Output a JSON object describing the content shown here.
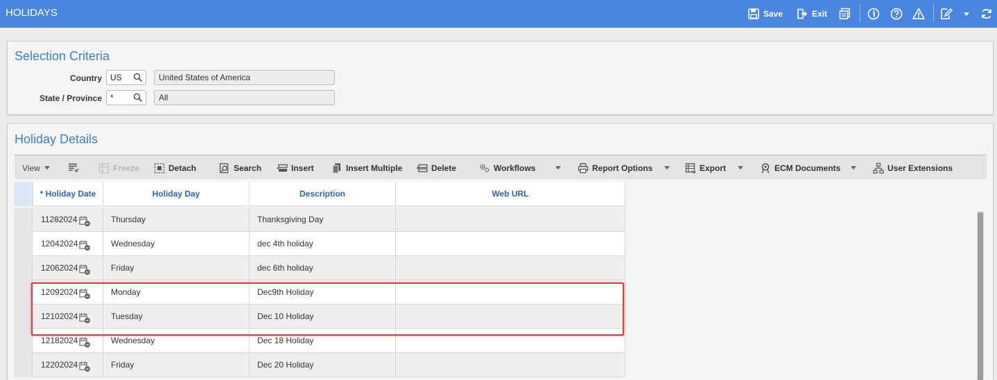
{
  "app": {
    "title": "HOLIDAYS",
    "actions": {
      "save": "Save",
      "exit": "Exit"
    },
    "accent_color": "#4a86e0"
  },
  "selection_criteria": {
    "title": "Selection Criteria",
    "country": {
      "label": "Country",
      "value": "US",
      "description": "United States of America"
    },
    "state": {
      "label": "State / Province",
      "value": "*",
      "description": "All"
    }
  },
  "holiday_details": {
    "title": "Holiday Details",
    "toolbar": {
      "view": "View",
      "freeze": "Freeze",
      "detach": "Detach",
      "search": "Search",
      "insert": "Insert",
      "insert_multiple": "Insert Multiple",
      "delete": "Delete",
      "workflows": "Workflows",
      "report_options": "Report Options",
      "export": "Export",
      "ecm_documents": "ECM Documents",
      "user_extensions": "User Extensions"
    },
    "columns": {
      "holiday_date": "* Holiday Date",
      "holiday_day": "Holiday Day",
      "description": "Description",
      "web_url": "Web URL"
    },
    "rows": [
      {
        "date": "11282024",
        "day": "Thursday",
        "description": "Thanksgiving Day",
        "url": ""
      },
      {
        "date": "12042024",
        "day": "Wednesday",
        "description": "dec 4th holiday",
        "url": ""
      },
      {
        "date": "12062024",
        "day": "Friday",
        "description": "dec 6th holiday",
        "url": ""
      },
      {
        "date": "12092024",
        "day": "Monday",
        "description": "Dec9th Holiday",
        "url": ""
      },
      {
        "date": "12102024",
        "day": "Tuesday",
        "description": "Dec 10 Holiday",
        "url": ""
      },
      {
        "date": "12182024",
        "day": "Wednesday",
        "description": "Dec 18 Holiday",
        "url": ""
      },
      {
        "date": "12202024",
        "day": "Friday",
        "description": "Dec 20 Holiday",
        "url": ""
      }
    ],
    "highlight_color": "#e0393e"
  }
}
